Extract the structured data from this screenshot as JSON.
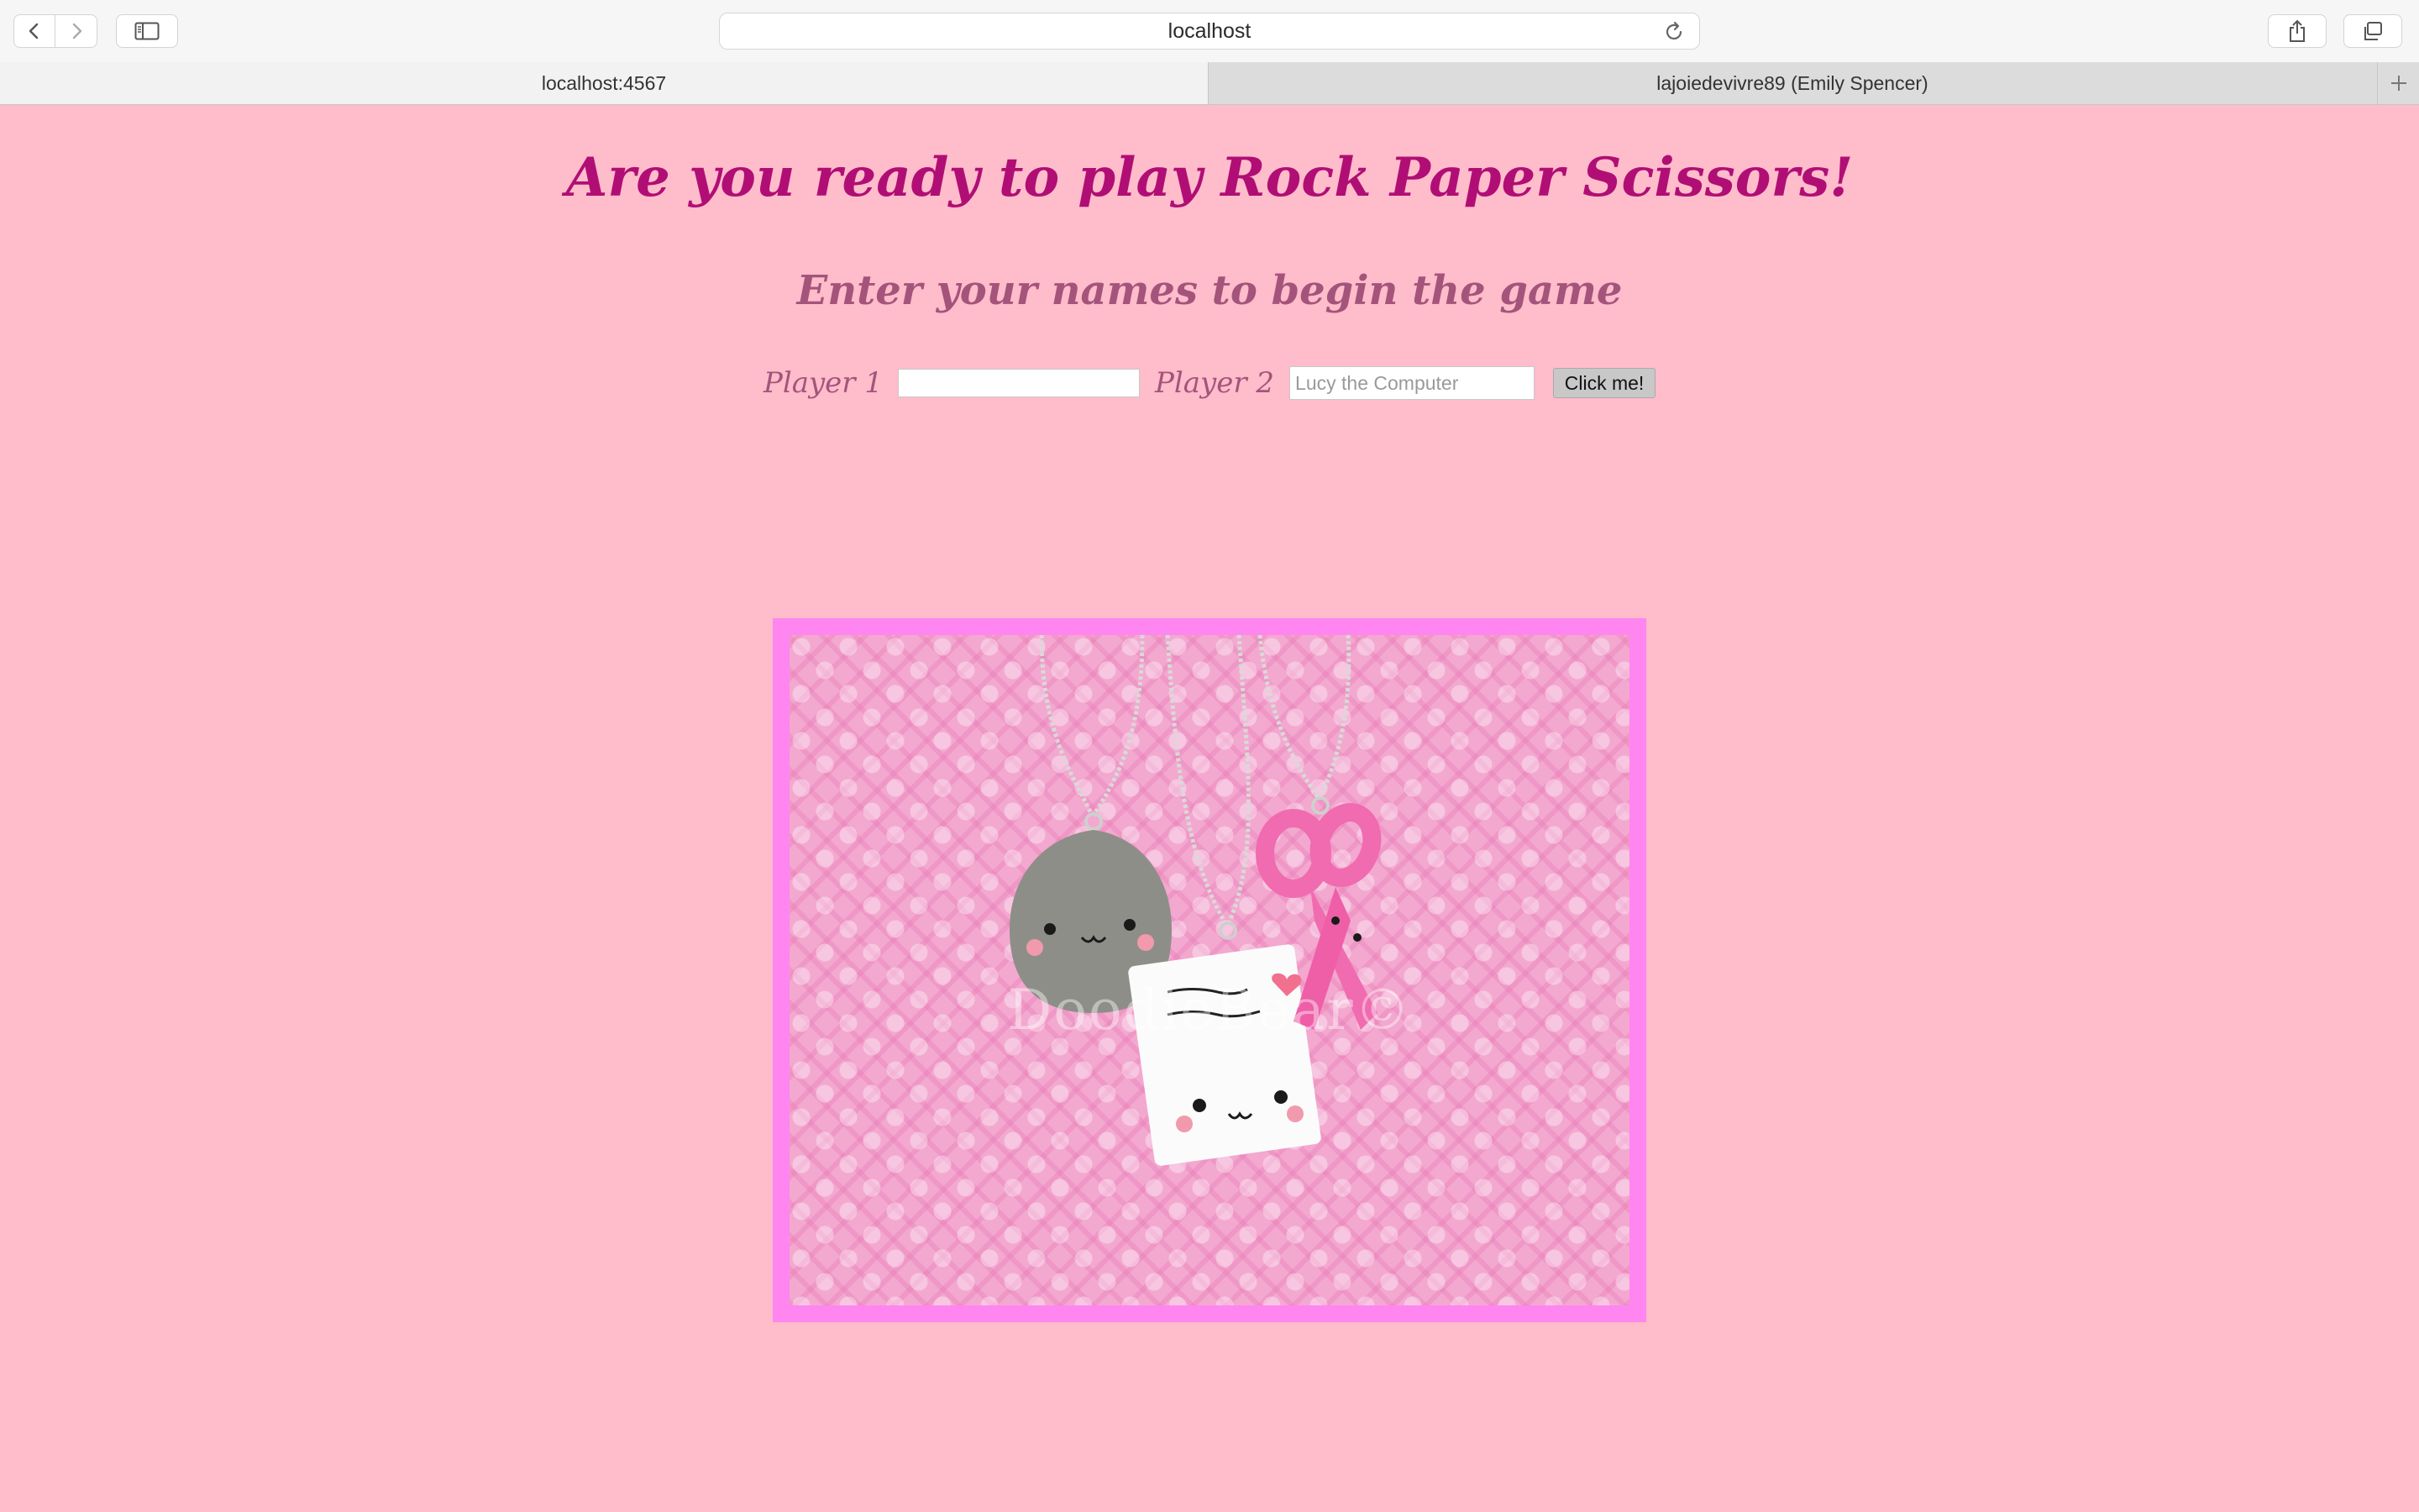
{
  "browser": {
    "url": "localhost",
    "tabs": [
      {
        "label": "localhost:4567",
        "active": true
      },
      {
        "label": "lajoiedevivre89 (Emily Spencer)",
        "active": false
      }
    ],
    "icons": [
      "chevron-left-icon",
      "chevron-right-icon",
      "sidebar-icon",
      "reload-icon",
      "share-icon",
      "tabs-overview-icon",
      "plus-icon"
    ]
  },
  "page": {
    "background": "#ffbccb",
    "title": "Are you ready to play Rock Paper Scissors!",
    "subtitle": "Enter your names to begin the game",
    "form": {
      "player1_label": "Player 1",
      "player1_value": "",
      "player2_label": "Player 2",
      "player2_placeholder": "Lucy the Computer",
      "submit_label": "Click me!"
    },
    "image": {
      "watermark": "DoodieBear©",
      "frame_color": "#ff86f0"
    }
  }
}
